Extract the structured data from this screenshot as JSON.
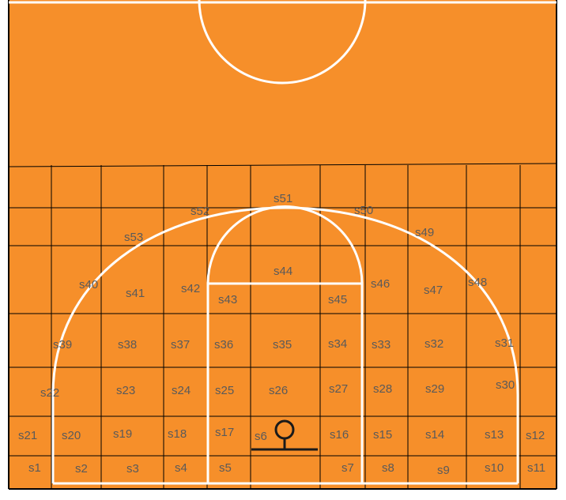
{
  "court": {
    "colors": {
      "floor": "#f68f2a",
      "court_lines": "#ffffff",
      "grid_lines": "#000000",
      "label_text": "#5a5a5a",
      "hoop": "#1a1a1a"
    }
  },
  "zone_labels": [
    "s1",
    "s2",
    "s3",
    "s4",
    "s5",
    "s6",
    "s7",
    "s8",
    "s9",
    "s10",
    "s11",
    "s12",
    "s13",
    "s14",
    "s15",
    "s16",
    "s17",
    "s18",
    "s19",
    "s20",
    "s21",
    "s22",
    "s23",
    "s24",
    "s25",
    "s26",
    "s27",
    "s28",
    "s29",
    "s30",
    "s31",
    "s32",
    "s33",
    "s34",
    "s35",
    "s36",
    "s37",
    "s38",
    "s39",
    "s40",
    "s41",
    "s42",
    "s43",
    "s44",
    "s45",
    "s46",
    "s47",
    "s48",
    "s49",
    "s50",
    "s51",
    "s52",
    "s53"
  ]
}
